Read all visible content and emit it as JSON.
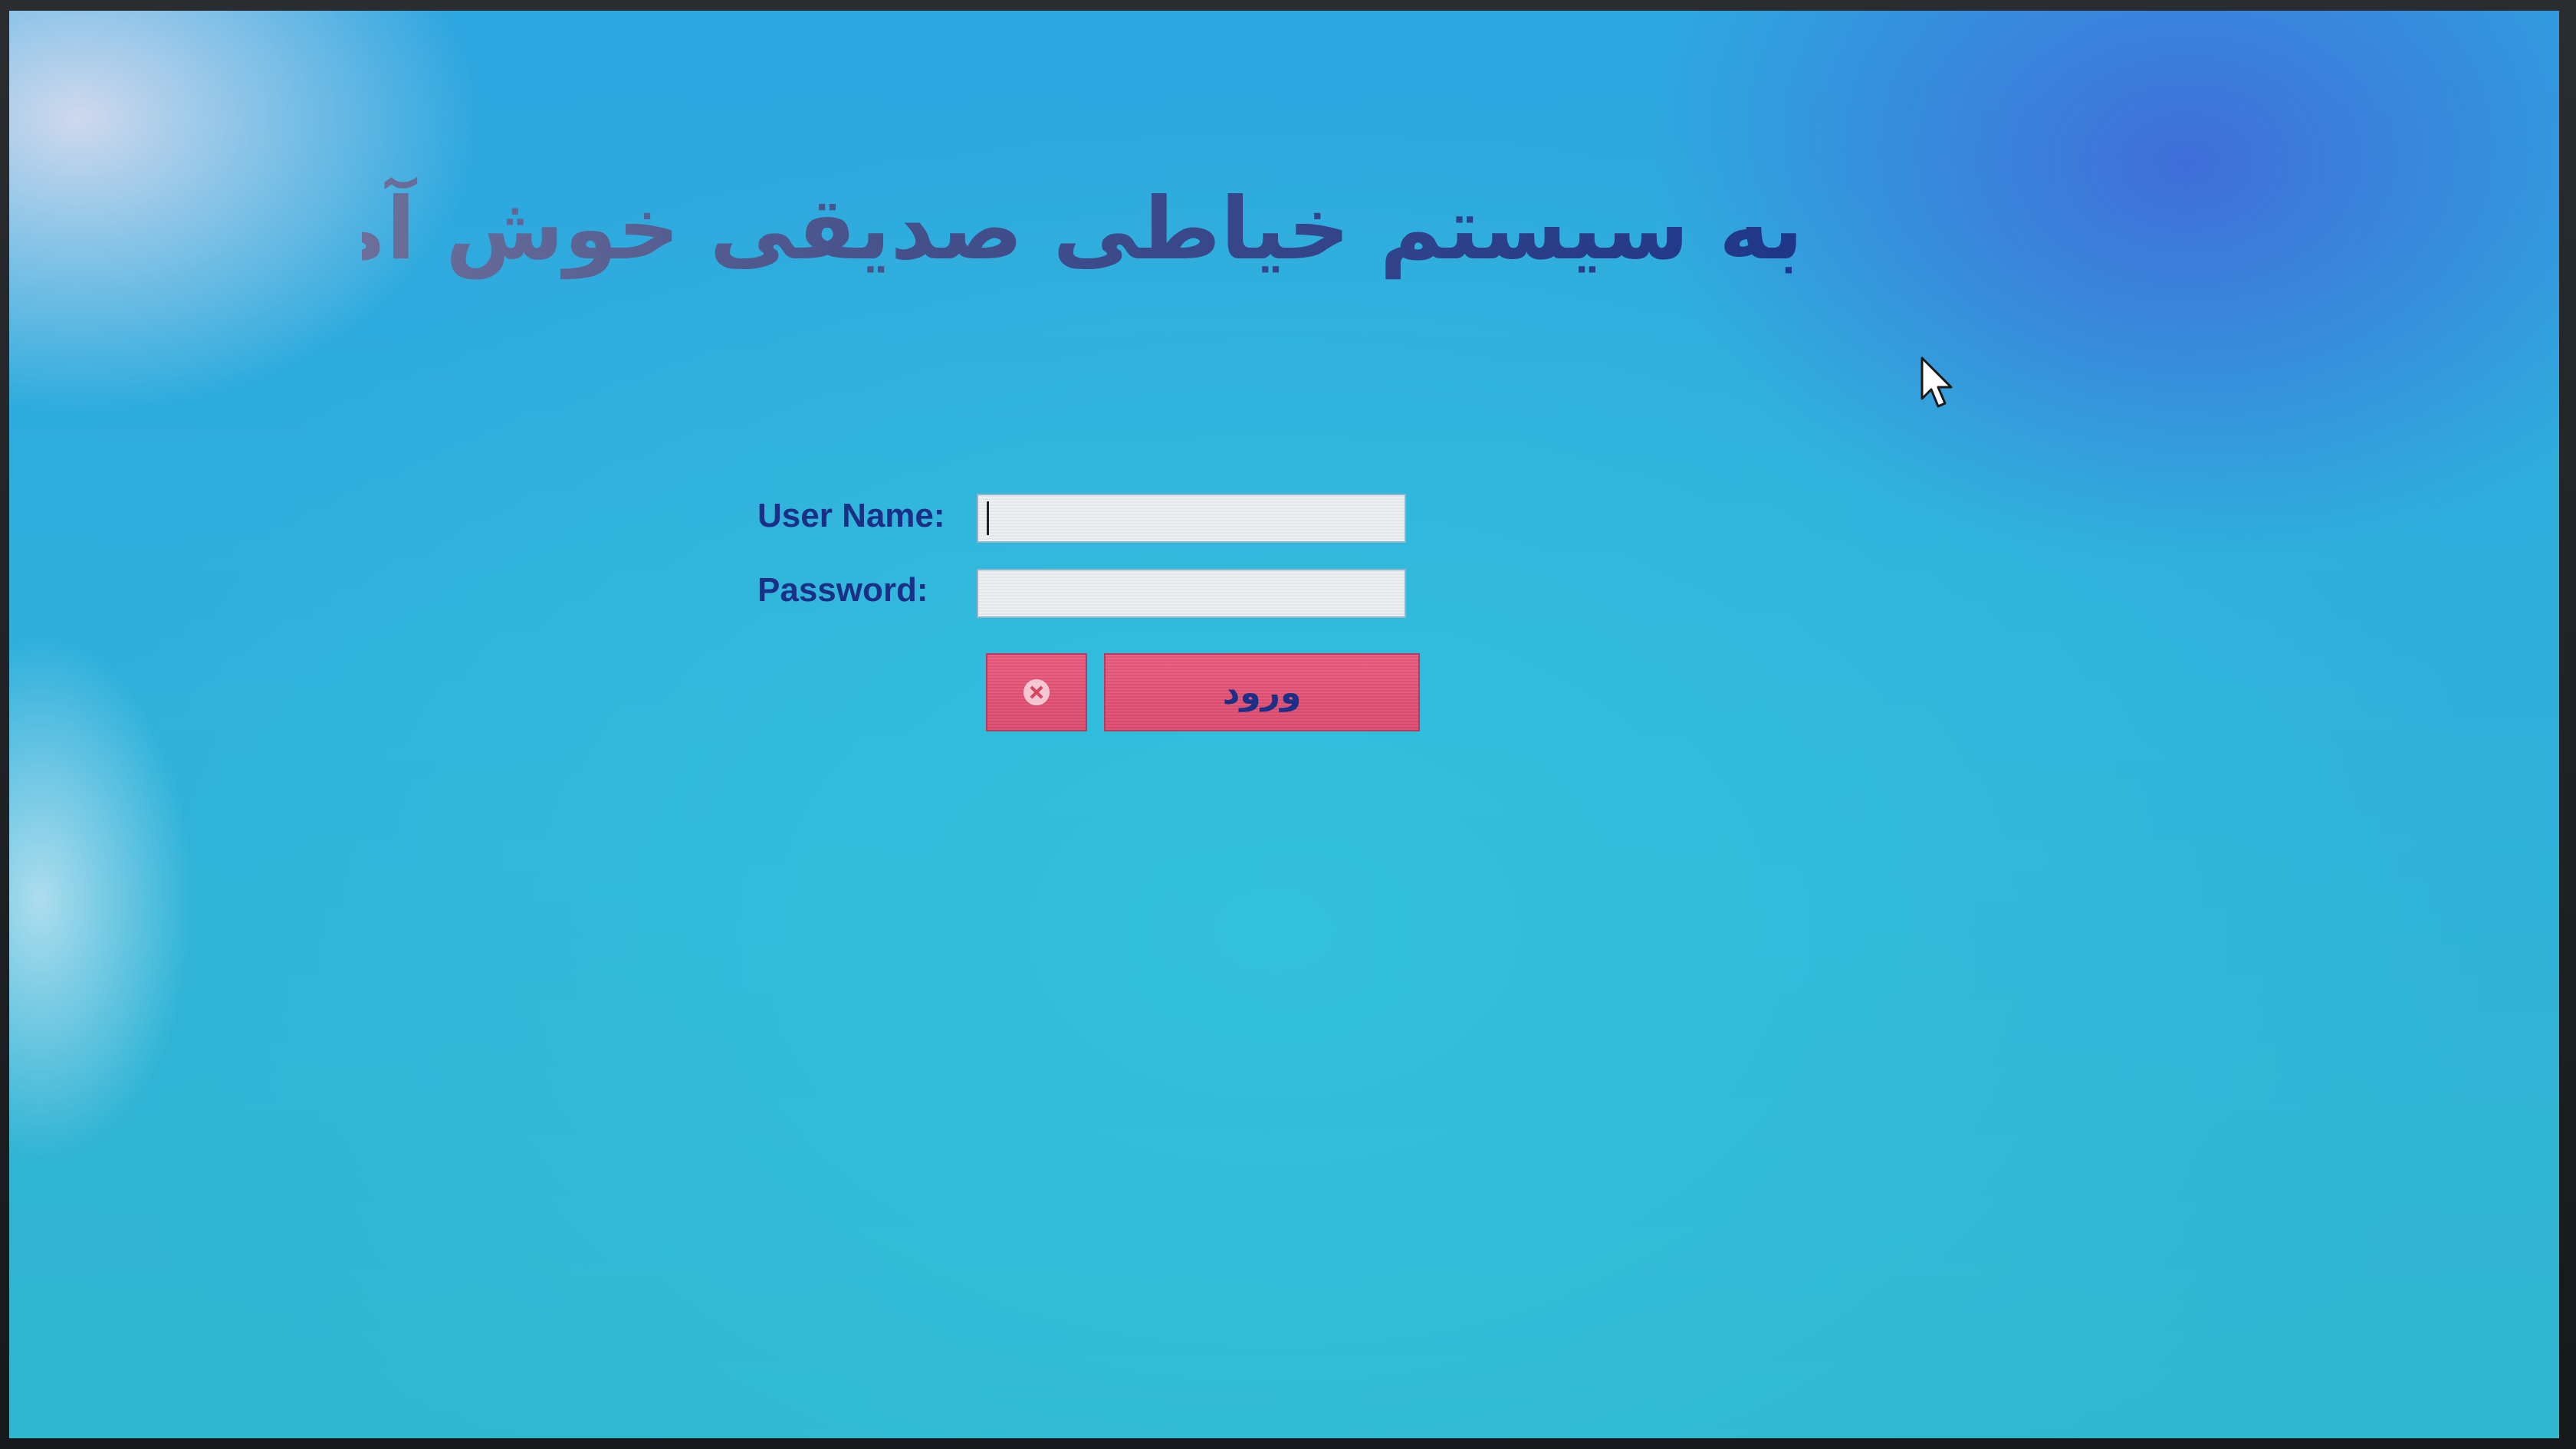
{
  "title": "به سیستم خیاطی صدیقی خوش آمدید",
  "login_form": {
    "username_label": "User Name:",
    "username_value": "",
    "password_label": "Password:",
    "password_value": "",
    "login_button_label": "ورود",
    "clear_button_icon": "clear-x-icon"
  },
  "colors": {
    "background": "#2fb0dc",
    "title_text": "#1f3688",
    "label_text": "#1c2f86",
    "button": "#e0506f"
  }
}
